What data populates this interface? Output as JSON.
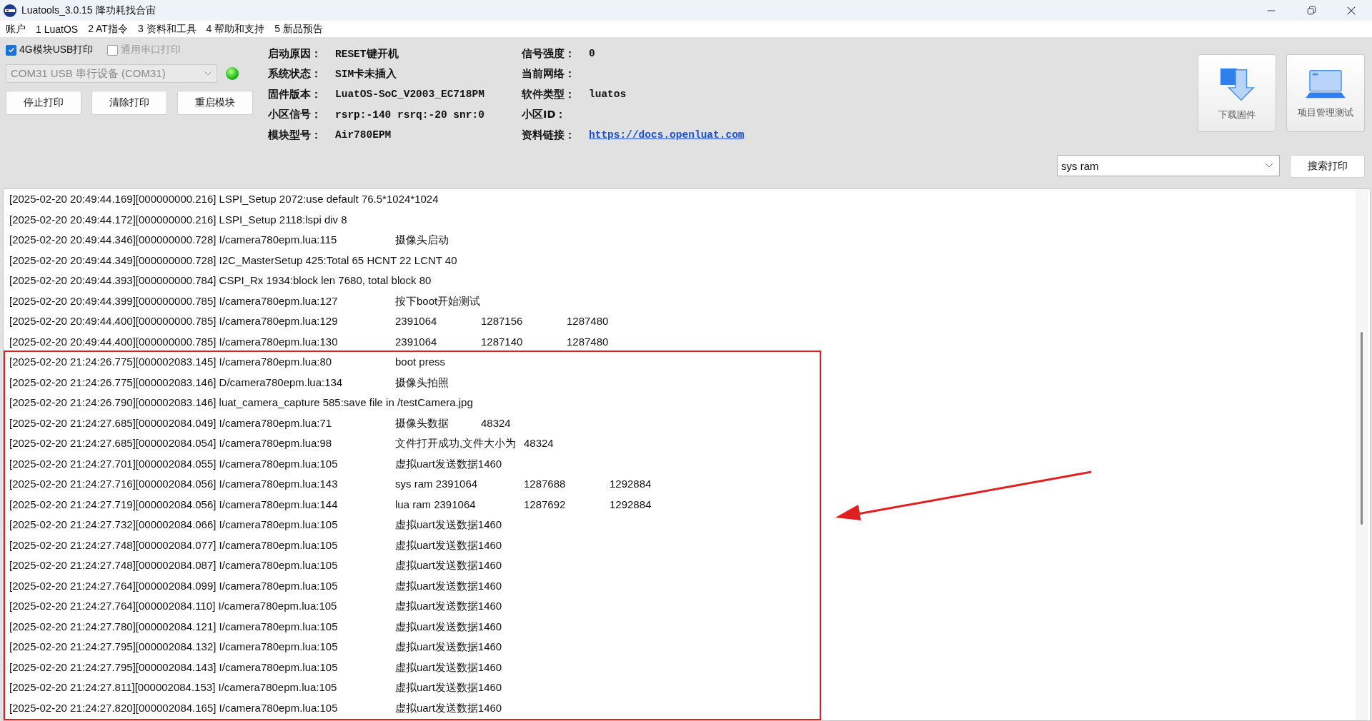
{
  "window": {
    "title": "Luatools_3.0.15 降功耗找合宙"
  },
  "menu": [
    "账户",
    "1 LuatOS",
    "2 AT指令",
    "3 资料和工具",
    "4 帮助和支持",
    "5 新品预告"
  ],
  "options": [
    {
      "label": "4G模块USB打印",
      "checked": true,
      "disabled": false
    },
    {
      "label": "通用串口打印",
      "checked": false,
      "disabled": true
    }
  ],
  "port": {
    "value": "COM31 USB 串行设备 (COM31)",
    "disabled": true,
    "connected": true
  },
  "buttons": [
    "停止打印",
    "清除打印",
    "重启模块"
  ],
  "device_info": [
    [
      {
        "label": "启动原因：",
        "value": "RESET键开机",
        "kind": "text"
      },
      {
        "label": "系统状态：",
        "value": "SIM卡未插入",
        "kind": "text"
      },
      {
        "label": "固件版本：",
        "value": "LuatOS-SoC_V2003_EC718PM",
        "kind": "text"
      },
      {
        "label": "小区信号：",
        "value": "rsrp:-140 rsrq:-20 snr:0",
        "kind": "text"
      },
      {
        "label": "模块型号：",
        "value": "Air780EPM",
        "kind": "text"
      }
    ],
    [
      {
        "label": "信号强度：",
        "value": "0",
        "kind": "text"
      },
      {
        "label": "当前网络："
      },
      {
        "label": "软件类型：",
        "value": "luatos",
        "kind": "text"
      },
      {
        "label": "小区ID："
      },
      {
        "label": "资料链接：",
        "value": "https://docs.openluat.com",
        "kind": "link"
      }
    ]
  ],
  "tools": [
    {
      "label": "下载固件",
      "kind": "download"
    },
    {
      "label": "项目管理测试",
      "kind": "laptop"
    }
  ],
  "search": {
    "value": "sys ram",
    "button": "搜索打印"
  },
  "log": {
    "lines": [
      {
        "source": "[2025-02-20 20:49:44.169][000000000.216] LSPI_Setup 2072:use default 76.5*1024*1024"
      },
      {
        "source": "[2025-02-20 20:49:44.172][000000000.216] LSPI_Setup 2118:lspi div 8"
      },
      {
        "source": "[2025-02-20 20:49:44.346][000000000.728] I/camera780epm.lua:115",
        "fields": [
          "摄像头启动"
        ]
      },
      {
        "source": "[2025-02-20 20:49:44.349][000000000.728] I2C_MasterSetup 425:Total 65 HCNT 22 LCNT 40"
      },
      {
        "source": "[2025-02-20 20:49:44.393][000000000.784] CSPI_Rx 1934:block len 7680, total block 80"
      },
      {
        "source": "[2025-02-20 20:49:44.399][000000000.785] I/camera780epm.lua:127",
        "fields": [
          "按下boot开始测试"
        ]
      },
      {
        "source": "[2025-02-20 20:49:44.400][000000000.785] I/camera780epm.lua:129",
        "fields": [
          "2391064",
          "1287156",
          "1287480"
        ]
      },
      {
        "source": "[2025-02-20 20:49:44.400][000000000.785] I/camera780epm.lua:130",
        "fields": [
          "2391064",
          "1287140",
          "1287480"
        ]
      },
      {
        "source": "[2025-02-20 21:24:26.775][000002083.145] I/camera780epm.lua:80",
        "fields": [
          "boot press"
        ]
      },
      {
        "source": "[2025-02-20 21:24:26.775][000002083.146] D/camera780epm.lua:134",
        "fields": [
          "摄像头拍照"
        ]
      },
      {
        "source": "[2025-02-20 21:24:26.790][000002083.146] luat_camera_capture 585:save file in /testCamera.jpg"
      },
      {
        "source": "[2025-02-20 21:24:27.685][000002084.049] I/camera780epm.lua:71",
        "fields": [
          "摄像头数据",
          "48324"
        ]
      },
      {
        "source": "[2025-02-20 21:24:27.685][000002084.054] I/camera780epm.lua:98",
        "fields": [
          "文件打开成功,文件大小为",
          "48324"
        ]
      },
      {
        "source": "[2025-02-20 21:24:27.701][000002084.055] I/camera780epm.lua:105",
        "fields": [
          "虚拟uart发送数据1460"
        ]
      },
      {
        "source": "[2025-02-20 21:24:27.716][000002084.056] I/camera780epm.lua:143",
        "fields": [
          "sys ram 2391064",
          "1287688",
          "1292884"
        ]
      },
      {
        "source": "[2025-02-20 21:24:27.719][000002084.056] I/camera780epm.lua:144",
        "fields": [
          "lua ram 2391064",
          "1287692",
          "1292884"
        ]
      },
      {
        "source": "[2025-02-20 21:24:27.732][000002084.066] I/camera780epm.lua:105",
        "fields": [
          "虚拟uart发送数据1460"
        ]
      },
      {
        "source": "[2025-02-20 21:24:27.748][000002084.077] I/camera780epm.lua:105",
        "fields": [
          "虚拟uart发送数据1460"
        ]
      },
      {
        "source": "[2025-02-20 21:24:27.748][000002084.087] I/camera780epm.lua:105",
        "fields": [
          "虚拟uart发送数据1460"
        ]
      },
      {
        "source": "[2025-02-20 21:24:27.764][000002084.099] I/camera780epm.lua:105",
        "fields": [
          "虚拟uart发送数据1460"
        ]
      },
      {
        "source": "[2025-02-20 21:24:27.764][000002084.110] I/camera780epm.lua:105",
        "fields": [
          "虚拟uart发送数据1460"
        ]
      },
      {
        "source": "[2025-02-20 21:24:27.780][000002084.121] I/camera780epm.lua:105",
        "fields": [
          "虚拟uart发送数据1460"
        ]
      },
      {
        "source": "[2025-02-20 21:24:27.795][000002084.132] I/camera780epm.lua:105",
        "fields": [
          "虚拟uart发送数据1460"
        ]
      },
      {
        "source": "[2025-02-20 21:24:27.795][000002084.143] I/camera780epm.lua:105",
        "fields": [
          "虚拟uart发送数据1460"
        ]
      },
      {
        "source": "[2025-02-20 21:24:27.811][000002084.153] I/camera780epm.lua:105",
        "fields": [
          "虚拟uart发送数据1460"
        ]
      },
      {
        "source": "[2025-02-20 21:24:27.820][000002084.165] I/camera780epm.lua:105",
        "fields": [
          "虚拟uart发送数据1460"
        ]
      }
    ]
  }
}
